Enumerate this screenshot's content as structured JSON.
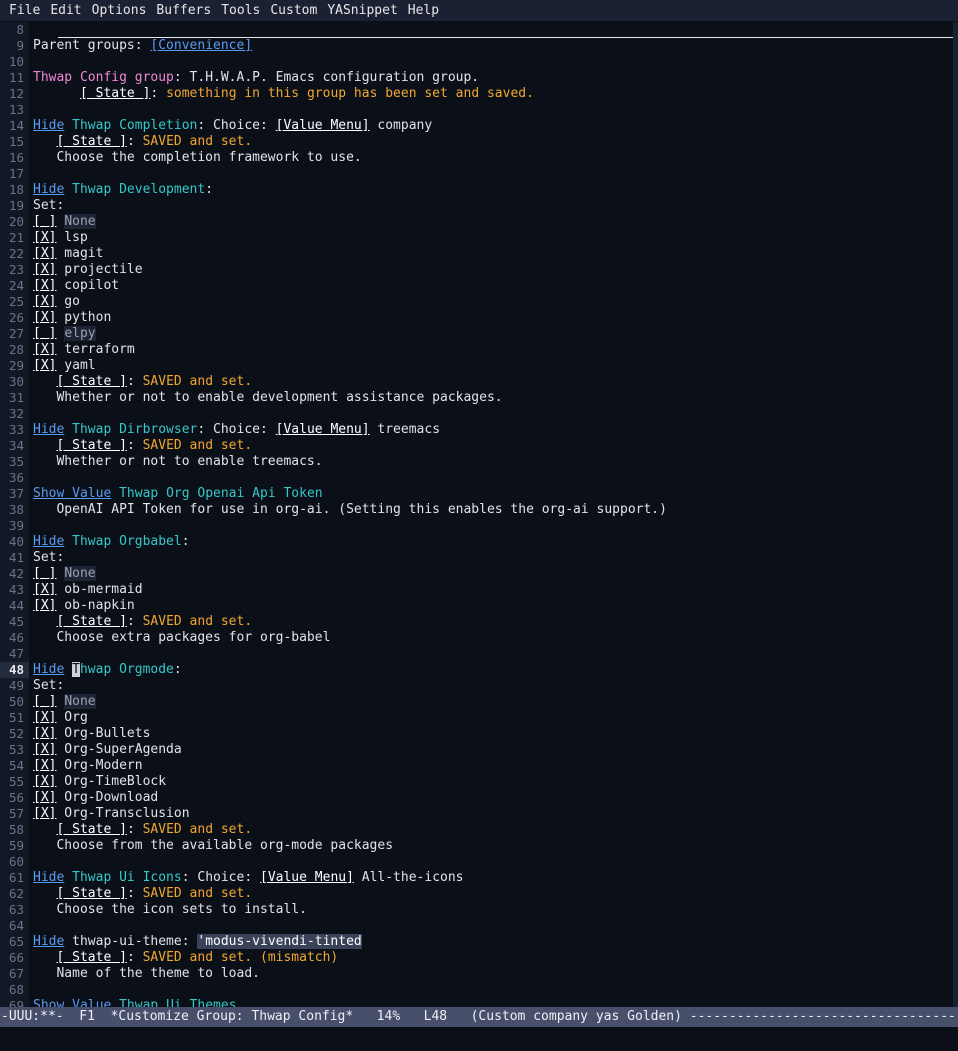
{
  "menubar": {
    "items": [
      {
        "label": "File"
      },
      {
        "label": "Edit"
      },
      {
        "label": "Options"
      },
      {
        "label": "Buffers"
      },
      {
        "label": "Tools"
      },
      {
        "label": "Custom"
      },
      {
        "label": "YASnippet"
      },
      {
        "label": "Help"
      }
    ]
  },
  "colors": {
    "background": "#0b0f18",
    "gutter": "#121826",
    "link": "#5a9bf0",
    "group_name": "#35c8c8",
    "magenta": "#ef86d4",
    "state_amber": "#f0a830",
    "modeline_bg": "#474f6b",
    "current_line_bg": "#242b3d"
  },
  "buffer": {
    "first_line_number": 8,
    "current_line_number": 48,
    "lines": [
      {
        "n": 8,
        "rule": true,
        "segs": []
      },
      {
        "n": 9,
        "segs": [
          {
            "t": "Parent groups: ",
            "f": "white"
          },
          {
            "t": "[Convenience]",
            "f": "link"
          }
        ]
      },
      {
        "n": 10,
        "segs": []
      },
      {
        "n": 11,
        "segs": [
          {
            "t": "Thwap Config group",
            "f": "magenta"
          },
          {
            "t": ": T.H.W.A.P. Emacs configuration group.",
            "f": "white"
          }
        ]
      },
      {
        "n": 12,
        "segs": [
          {
            "t": "      ",
            "f": "white"
          },
          {
            "t": "[ State ]",
            "f": "state"
          },
          {
            "t": ": ",
            "f": "white"
          },
          {
            "t": "something in this group has been set and saved.",
            "f": "amber"
          }
        ]
      },
      {
        "n": 13,
        "segs": []
      },
      {
        "n": 14,
        "segs": [
          {
            "t": "Hide",
            "f": "link"
          },
          {
            "t": " ",
            "f": "white"
          },
          {
            "t": "Thwap Completion",
            "f": "grp"
          },
          {
            "t": ": Choice: ",
            "f": "white"
          },
          {
            "t": "[Value Menu]",
            "f": "box"
          },
          {
            "t": " company",
            "f": "white"
          }
        ]
      },
      {
        "n": 15,
        "segs": [
          {
            "t": "   ",
            "f": "white"
          },
          {
            "t": "[ State ]",
            "f": "state"
          },
          {
            "t": ": ",
            "f": "white"
          },
          {
            "t": "SAVED and set.",
            "f": "amber"
          }
        ]
      },
      {
        "n": 16,
        "segs": [
          {
            "t": "   Choose the completion framework to use.",
            "f": "white"
          }
        ]
      },
      {
        "n": 17,
        "segs": []
      },
      {
        "n": 18,
        "segs": [
          {
            "t": "Hide",
            "f": "link"
          },
          {
            "t": " ",
            "f": "white"
          },
          {
            "t": "Thwap Development",
            "f": "grp"
          },
          {
            "t": ":",
            "f": "white"
          }
        ]
      },
      {
        "n": 19,
        "segs": [
          {
            "t": "Set:",
            "f": "white"
          }
        ]
      },
      {
        "n": 20,
        "segs": [
          {
            "t": "[ ]",
            "f": "box"
          },
          {
            "t": " ",
            "f": "white"
          },
          {
            "t": "None",
            "f": "dim"
          }
        ]
      },
      {
        "n": 21,
        "segs": [
          {
            "t": "[X]",
            "f": "box"
          },
          {
            "t": " lsp",
            "f": "white"
          }
        ]
      },
      {
        "n": 22,
        "segs": [
          {
            "t": "[X]",
            "f": "box"
          },
          {
            "t": " magit",
            "f": "white"
          }
        ]
      },
      {
        "n": 23,
        "segs": [
          {
            "t": "[X]",
            "f": "box"
          },
          {
            "t": " projectile",
            "f": "white"
          }
        ]
      },
      {
        "n": 24,
        "segs": [
          {
            "t": "[X]",
            "f": "box"
          },
          {
            "t": " copilot",
            "f": "white"
          }
        ]
      },
      {
        "n": 25,
        "segs": [
          {
            "t": "[X]",
            "f": "box"
          },
          {
            "t": " go",
            "f": "white"
          }
        ]
      },
      {
        "n": 26,
        "segs": [
          {
            "t": "[X]",
            "f": "box"
          },
          {
            "t": " python",
            "f": "white"
          }
        ]
      },
      {
        "n": 27,
        "segs": [
          {
            "t": "[ ]",
            "f": "box"
          },
          {
            "t": " ",
            "f": "white"
          },
          {
            "t": "elpy",
            "f": "dim"
          }
        ]
      },
      {
        "n": 28,
        "segs": [
          {
            "t": "[X]",
            "f": "box"
          },
          {
            "t": " terraform",
            "f": "white"
          }
        ]
      },
      {
        "n": 29,
        "segs": [
          {
            "t": "[X]",
            "f": "box"
          },
          {
            "t": " yaml",
            "f": "white"
          }
        ]
      },
      {
        "n": 30,
        "segs": [
          {
            "t": "   ",
            "f": "white"
          },
          {
            "t": "[ State ]",
            "f": "state"
          },
          {
            "t": ": ",
            "f": "white"
          },
          {
            "t": "SAVED and set.",
            "f": "amber"
          }
        ]
      },
      {
        "n": 31,
        "segs": [
          {
            "t": "   Whether or not to enable development assistance packages.",
            "f": "white"
          }
        ]
      },
      {
        "n": 32,
        "segs": []
      },
      {
        "n": 33,
        "segs": [
          {
            "t": "Hide",
            "f": "link"
          },
          {
            "t": " ",
            "f": "white"
          },
          {
            "t": "Thwap Dirbrowser",
            "f": "grp"
          },
          {
            "t": ": Choice: ",
            "f": "white"
          },
          {
            "t": "[Value Menu]",
            "f": "box"
          },
          {
            "t": " treemacs",
            "f": "white"
          }
        ]
      },
      {
        "n": 34,
        "segs": [
          {
            "t": "   ",
            "f": "white"
          },
          {
            "t": "[ State ]",
            "f": "state"
          },
          {
            "t": ": ",
            "f": "white"
          },
          {
            "t": "SAVED and set.",
            "f": "amber"
          }
        ]
      },
      {
        "n": 35,
        "segs": [
          {
            "t": "   Whether or not to enable treemacs.",
            "f": "white"
          }
        ]
      },
      {
        "n": 36,
        "segs": []
      },
      {
        "n": 37,
        "segs": [
          {
            "t": "Show Value",
            "f": "link"
          },
          {
            "t": " ",
            "f": "white"
          },
          {
            "t": "Thwap Org Openai Api Token",
            "f": "grp"
          }
        ]
      },
      {
        "n": 38,
        "segs": [
          {
            "t": "   OpenAI API Token for use in org-ai. (Setting this enables the org-ai support.)",
            "f": "white"
          }
        ]
      },
      {
        "n": 39,
        "segs": []
      },
      {
        "n": 40,
        "segs": [
          {
            "t": "Hide",
            "f": "link"
          },
          {
            "t": " ",
            "f": "white"
          },
          {
            "t": "Thwap Orgbabel",
            "f": "grp"
          },
          {
            "t": ":",
            "f": "white"
          }
        ]
      },
      {
        "n": 41,
        "segs": [
          {
            "t": "Set:",
            "f": "white"
          }
        ]
      },
      {
        "n": 42,
        "segs": [
          {
            "t": "[ ]",
            "f": "box"
          },
          {
            "t": " ",
            "f": "white"
          },
          {
            "t": "None",
            "f": "dim"
          }
        ]
      },
      {
        "n": 43,
        "segs": [
          {
            "t": "[X]",
            "f": "box"
          },
          {
            "t": " ob-mermaid",
            "f": "white"
          }
        ]
      },
      {
        "n": 44,
        "segs": [
          {
            "t": "[X]",
            "f": "box"
          },
          {
            "t": " ob-napkin",
            "f": "white"
          }
        ]
      },
      {
        "n": 45,
        "segs": [
          {
            "t": "   ",
            "f": "white"
          },
          {
            "t": "[ State ]",
            "f": "state"
          },
          {
            "t": ": ",
            "f": "white"
          },
          {
            "t": "SAVED and set.",
            "f": "amber"
          }
        ]
      },
      {
        "n": 46,
        "segs": [
          {
            "t": "   Choose extra packages for org-babel",
            "f": "white"
          }
        ]
      },
      {
        "n": 47,
        "segs": []
      },
      {
        "n": 48,
        "current": true,
        "segs": [
          {
            "t": "Hide",
            "f": "link"
          },
          {
            "t": " ",
            "f": "white"
          },
          {
            "t": "T",
            "f": "cursor"
          },
          {
            "t": "hwap Orgmode",
            "f": "grp"
          },
          {
            "t": ":",
            "f": "white"
          }
        ]
      },
      {
        "n": 49,
        "segs": [
          {
            "t": "Set:",
            "f": "white"
          }
        ]
      },
      {
        "n": 50,
        "segs": [
          {
            "t": "[ ]",
            "f": "box"
          },
          {
            "t": " ",
            "f": "white"
          },
          {
            "t": "None",
            "f": "dim"
          }
        ]
      },
      {
        "n": 51,
        "segs": [
          {
            "t": "[X]",
            "f": "box"
          },
          {
            "t": " Org",
            "f": "white"
          }
        ]
      },
      {
        "n": 52,
        "segs": [
          {
            "t": "[X]",
            "f": "box"
          },
          {
            "t": " Org-Bullets",
            "f": "white"
          }
        ]
      },
      {
        "n": 53,
        "segs": [
          {
            "t": "[X]",
            "f": "box"
          },
          {
            "t": " Org-SuperAgenda",
            "f": "white"
          }
        ]
      },
      {
        "n": 54,
        "segs": [
          {
            "t": "[X]",
            "f": "box"
          },
          {
            "t": " Org-Modern",
            "f": "white"
          }
        ]
      },
      {
        "n": 55,
        "segs": [
          {
            "t": "[X]",
            "f": "box"
          },
          {
            "t": " Org-TimeBlock",
            "f": "white"
          }
        ]
      },
      {
        "n": 56,
        "segs": [
          {
            "t": "[X]",
            "f": "box"
          },
          {
            "t": " Org-Download",
            "f": "white"
          }
        ]
      },
      {
        "n": 57,
        "segs": [
          {
            "t": "[X]",
            "f": "box"
          },
          {
            "t": " Org-Transclusion",
            "f": "white"
          }
        ]
      },
      {
        "n": 58,
        "segs": [
          {
            "t": "   ",
            "f": "white"
          },
          {
            "t": "[ State ]",
            "f": "state"
          },
          {
            "t": ": ",
            "f": "white"
          },
          {
            "t": "SAVED and set.",
            "f": "amber"
          }
        ]
      },
      {
        "n": 59,
        "segs": [
          {
            "t": "   Choose from the available org-mode packages",
            "f": "white"
          }
        ]
      },
      {
        "n": 60,
        "segs": []
      },
      {
        "n": 61,
        "segs": [
          {
            "t": "Hide",
            "f": "link"
          },
          {
            "t": " ",
            "f": "white"
          },
          {
            "t": "Thwap Ui Icons",
            "f": "grp"
          },
          {
            "t": ": Choice: ",
            "f": "white"
          },
          {
            "t": "[Value Menu]",
            "f": "box"
          },
          {
            "t": " All-the-icons",
            "f": "white"
          }
        ]
      },
      {
        "n": 62,
        "segs": [
          {
            "t": "   ",
            "f": "white"
          },
          {
            "t": "[ State ]",
            "f": "state"
          },
          {
            "t": ": ",
            "f": "white"
          },
          {
            "t": "SAVED and set.",
            "f": "amber"
          }
        ]
      },
      {
        "n": 63,
        "segs": [
          {
            "t": "   Choose the icon sets to install.",
            "f": "white"
          }
        ]
      },
      {
        "n": 64,
        "segs": []
      },
      {
        "n": 65,
        "segs": [
          {
            "t": "Hide",
            "f": "link"
          },
          {
            "t": " ",
            "f": "white"
          },
          {
            "t": "thwap-ui-theme",
            "f": "plainname"
          },
          {
            "t": ": ",
            "f": "white"
          },
          {
            "t": "'modus-vivendi-tinted",
            "f": "valbox"
          }
        ]
      },
      {
        "n": 66,
        "segs": [
          {
            "t": "   ",
            "f": "white"
          },
          {
            "t": "[ State ]",
            "f": "state"
          },
          {
            "t": ": ",
            "f": "white"
          },
          {
            "t": "SAVED and set. (mismatch)",
            "f": "amber"
          }
        ]
      },
      {
        "n": 67,
        "segs": [
          {
            "t": "   Name of the theme to load.",
            "f": "white"
          }
        ]
      },
      {
        "n": 68,
        "segs": []
      },
      {
        "n": 69,
        "segs": [
          {
            "t": "Show Value",
            "f": "link"
          },
          {
            "t": " ",
            "f": "white"
          },
          {
            "t": "Thwap Ui Themes",
            "f": "grp"
          }
        ]
      }
    ]
  },
  "modeline": {
    "text": "-UUU:**-  F1  *Customize Group: Thwap Config*   14%   L48   (Custom company yas Golden) ---------------------------------------------------",
    "coding": "-UUU:**-",
    "frame": "F1",
    "buffer_name": "*Customize Group: Thwap Config*",
    "percent": "14%",
    "line_indicator": "L48",
    "modes": "(Custom company yas Golden)"
  }
}
